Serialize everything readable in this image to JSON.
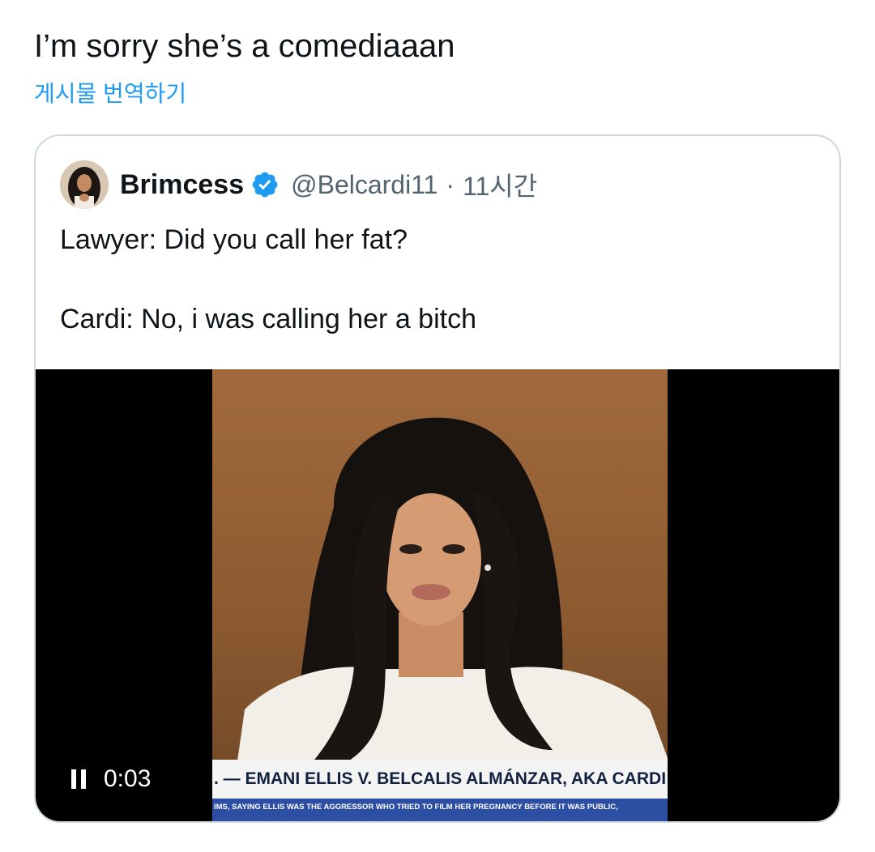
{
  "tweet": {
    "text": "I’m sorry she’s a comediaaan",
    "translate_label": "게시물 번역하기"
  },
  "quote": {
    "display_name": "Brimcess",
    "handle": "@Belcardi11",
    "separator": "·",
    "time": "11시간",
    "text_line1": "Lawyer: Did you call her fat?",
    "text_line2": "Cardi: No, i was calling her a bitch",
    "verified_icon": "verified-badge-icon",
    "verified_color": "#1d9bf0"
  },
  "video": {
    "time": "0:03",
    "chyron_main": ". — EMANI ELLIS V. BELCALIS ALMÁNZAR, AKA CARDI",
    "chyron_sub": "IMS, SAYING ELLIS WAS THE AGGRESSOR WHO TRIED TO FILM HER PREGNANCY BEFORE IT WAS PUBLIC,",
    "pause_icon": "pause-icon"
  },
  "colors": {
    "link": "#1d9bf0",
    "border": "#cfd9de",
    "secondary_text": "#536471",
    "chyron_bg": "#f4f4f4",
    "chyron_sub_bg": "#2d4fa3"
  }
}
